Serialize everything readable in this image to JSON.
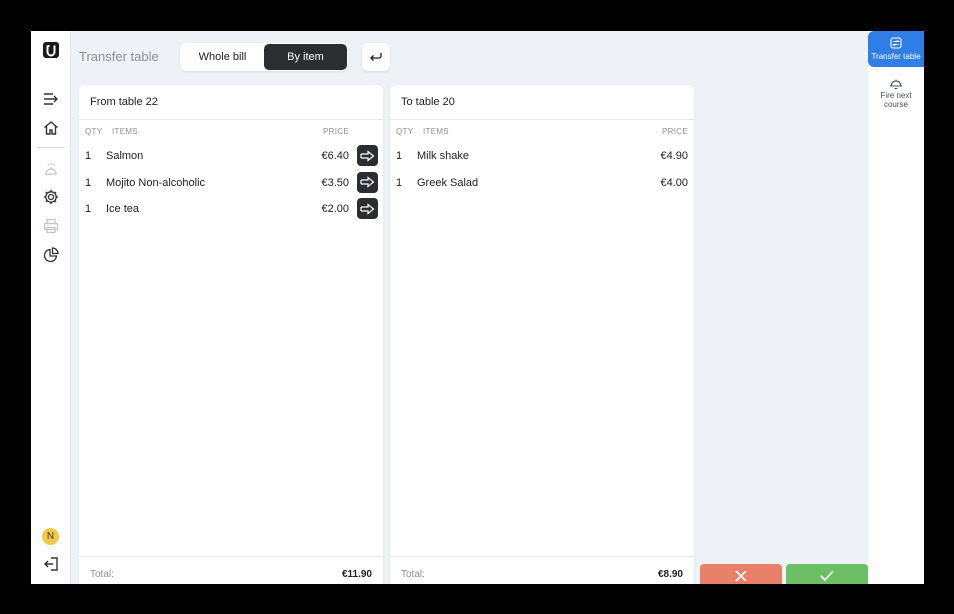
{
  "header": {
    "title": "Transfer table",
    "segments": [
      "Whole bill",
      "By item"
    ],
    "active_segment": "By item"
  },
  "sidebar": {
    "logo": "U",
    "icons": [
      "collapse-menu-icon",
      "home-icon",
      "service-bell-icon",
      "gear-icon",
      "printer-icon",
      "pie-chart-icon"
    ],
    "avatar_initial": "N",
    "logout_icon": "logout-icon"
  },
  "from_panel": {
    "title": "From table 22",
    "columns": {
      "qty": "QTY",
      "items": "ITEMS",
      "price": "PRICE"
    },
    "rows": [
      {
        "qty": "1",
        "item": "Salmon",
        "price": "€6.40"
      },
      {
        "qty": "1",
        "item": "Mojito Non-alcoholic",
        "price": "€3.50"
      },
      {
        "qty": "1",
        "item": "Ice tea",
        "price": "€2.00"
      }
    ],
    "total_label": "Total:",
    "total": "€11.90"
  },
  "to_panel": {
    "title": "To table 20",
    "columns": {
      "qty": "QTY",
      "items": "ITEMS",
      "price": "PRICE"
    },
    "rows": [
      {
        "qty": "1",
        "item": "Milk shake",
        "price": "€4.90"
      },
      {
        "qty": "1",
        "item": "Greek Salad",
        "price": "€4.00"
      }
    ],
    "total_label": "Total:",
    "total": "€8.90"
  },
  "right_rail": {
    "items": [
      {
        "label": "Transfer table",
        "icon": "transfer-table-icon",
        "active": true
      },
      {
        "label": "Fire next course",
        "icon": "cloche-icon",
        "active": false
      }
    ]
  },
  "colors": {
    "accent": "#2f7ee6",
    "cancel": "#e9806a",
    "confirm": "#6dbf66",
    "dark": "#2b2d31"
  }
}
